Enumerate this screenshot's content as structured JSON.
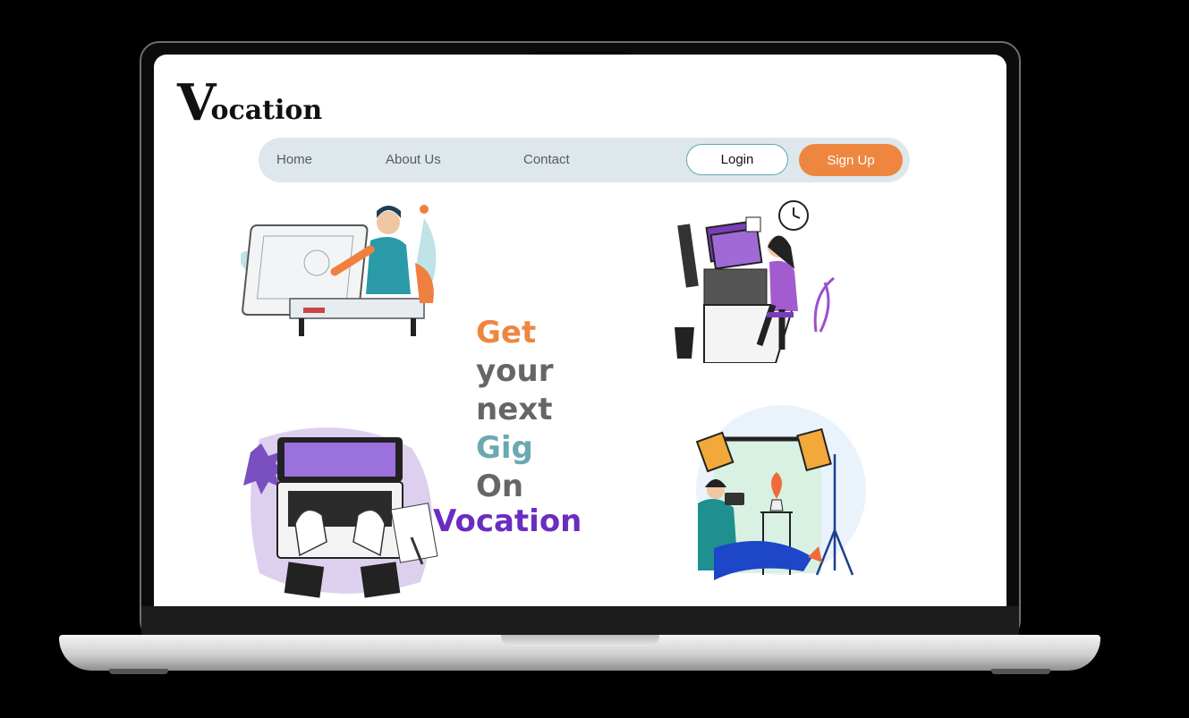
{
  "app": {
    "logo": {
      "initial": "V",
      "rest": "ocation"
    }
  },
  "nav": {
    "links": [
      {
        "label": "Home"
      },
      {
        "label": "About Us"
      },
      {
        "label": "Contact"
      }
    ],
    "login_label": "Login",
    "signup_label": "Sign Up"
  },
  "hero": {
    "lines": [
      {
        "text": "Get",
        "color": "#ee8640"
      },
      {
        "text": "your",
        "color": "#666666"
      },
      {
        "text": "next",
        "color": "#666666"
      },
      {
        "text": "Gig",
        "color": "#6aa9b2"
      },
      {
        "text": "On",
        "color": "#666666"
      }
    ],
    "brand": {
      "text": "Vocation",
      "color": "#6a2dbf"
    }
  },
  "colors": {
    "accent_orange": "#ee8640",
    "nav_bg": "#dde7ec",
    "teal": "#6aa9b2",
    "purple": "#6a2dbf"
  },
  "illustrations": [
    "designer-at-drafting-table",
    "woman-graphic-designer",
    "hands-typing-laptop",
    "photographer-in-studio"
  ]
}
